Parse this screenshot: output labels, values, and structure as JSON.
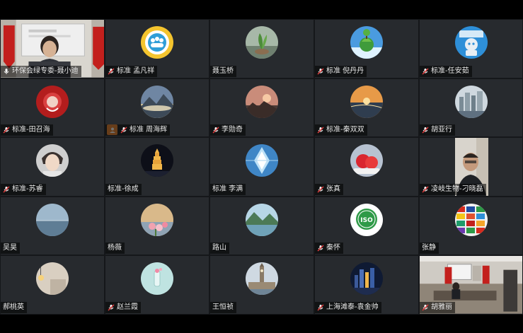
{
  "participants": [
    {
      "name": "环保会绿专委-聂小迪",
      "mic": "active",
      "tile": "video-room"
    },
    {
      "name": "标准 孟凡祥",
      "mic": "muted",
      "avatar": "people-icon"
    },
    {
      "name": "聂玉桥",
      "mic": "none",
      "avatar": "plant-icon"
    },
    {
      "name": "标准 倪丹丹",
      "mic": "muted",
      "avatar": "globe-tree-icon"
    },
    {
      "name": "标准-任安茹",
      "mic": "muted",
      "avatar": "robot-icon"
    },
    {
      "name": "标准-田召海",
      "mic": "muted",
      "avatar": "seal-icon"
    },
    {
      "name": "标准 周海辉",
      "mic": "muted",
      "avatar": "mountain-icon",
      "camera_off": true
    },
    {
      "name": "李勋奇",
      "mic": "muted",
      "avatar": "sunset-icon"
    },
    {
      "name": "标准-秦双双",
      "mic": "muted",
      "avatar": "sea-sunset-icon"
    },
    {
      "name": "胡亚行",
      "mic": "muted",
      "avatar": "city-icon"
    },
    {
      "name": "标准-苏睿",
      "mic": "muted",
      "avatar": "anime-portrait-icon"
    },
    {
      "name": "标准-徐成",
      "mic": "none",
      "avatar": "pagoda-icon"
    },
    {
      "name": "标准  李满",
      "mic": "none",
      "avatar": "crystal-icon"
    },
    {
      "name": "张真",
      "mic": "muted",
      "avatar": "strawberry-icon"
    },
    {
      "name": "凌岐生物-刁晓磊",
      "mic": "muted",
      "tile": "video-portrait"
    },
    {
      "name": "吴昊",
      "mic": "none",
      "avatar": "sea-icon"
    },
    {
      "name": "杨薇",
      "mic": "none",
      "avatar": "flower-icon"
    },
    {
      "name": "路山",
      "mic": "none",
      "avatar": "lake-icon"
    },
    {
      "name": "秦怀",
      "mic": "muted",
      "avatar": "iso-icon"
    },
    {
      "name": "张静",
      "mic": "none",
      "avatar": "flags-icon"
    },
    {
      "name": "郝桃英",
      "mic": "none",
      "avatar": "lamp-icon"
    },
    {
      "name": "赵兰霞",
      "mic": "muted",
      "avatar": "bottle-icon"
    },
    {
      "name": "王恒祯",
      "mic": "none",
      "avatar": "bigben-icon"
    },
    {
      "name": "上海滩泰-袁金帅",
      "mic": "muted",
      "avatar": "city-night-icon"
    },
    {
      "name": "胡雅丽",
      "mic": "muted",
      "tile": "video-office"
    }
  ],
  "iso_text": "ISO"
}
